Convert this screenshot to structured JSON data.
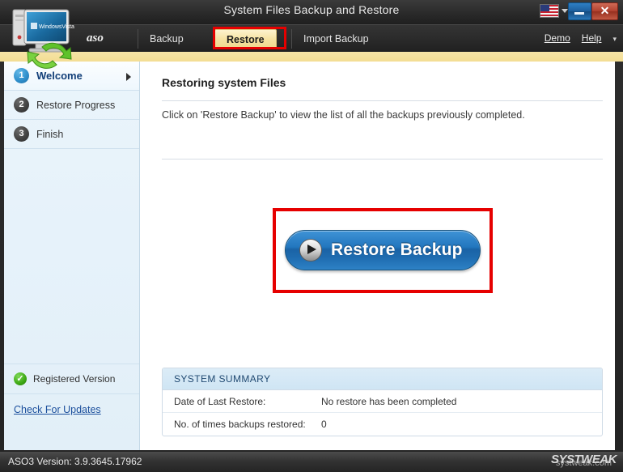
{
  "window": {
    "title": "System Files Backup and Restore",
    "minimize_label": "–",
    "close_label": "✕",
    "language_icon": "us-flag-icon"
  },
  "menubar": {
    "brand": "aso",
    "tabs": [
      {
        "label": "Backup",
        "active": false
      },
      {
        "label": "Restore",
        "active": true
      },
      {
        "label": "Import Backup",
        "active": false
      }
    ],
    "links": [
      {
        "label": "Demo"
      },
      {
        "label": "Help"
      }
    ],
    "help_caret": "▾"
  },
  "sidebar": {
    "items": [
      {
        "number": "1",
        "label": "Welcome",
        "active": true,
        "arrow": "▶"
      },
      {
        "number": "2",
        "label": "Restore Progress",
        "active": false
      },
      {
        "number": "3",
        "label": "Finish",
        "active": false
      }
    ],
    "registered": {
      "icon": "✓",
      "label": "Registered Version"
    },
    "updates_link": "Check For Updates"
  },
  "main": {
    "title": "Restoring system Files",
    "description": "Click on 'Restore Backup' to view the list of all the backups previously completed.",
    "primary_button": {
      "label": "Restore Backup",
      "icon": "play-icon"
    },
    "summary": {
      "header": "SYSTEM SUMMARY",
      "rows": [
        {
          "key": "Date of Last Restore:",
          "value": "No restore has been completed"
        },
        {
          "key": "No. of times backups restored:",
          "value": "0"
        }
      ]
    }
  },
  "statusbar": {
    "version_text": "ASO3 Version: 3.9.3645.17962",
    "watermark": "SYSTWEAK",
    "watermark_sub": "systweak.com"
  },
  "colors": {
    "accent_blue": "#2276be",
    "highlight_red": "#e60000",
    "tab_active_bg": "#f6e3a3",
    "sidebar_bg": "#e6f2fa",
    "link_blue": "#1b4f9c"
  }
}
